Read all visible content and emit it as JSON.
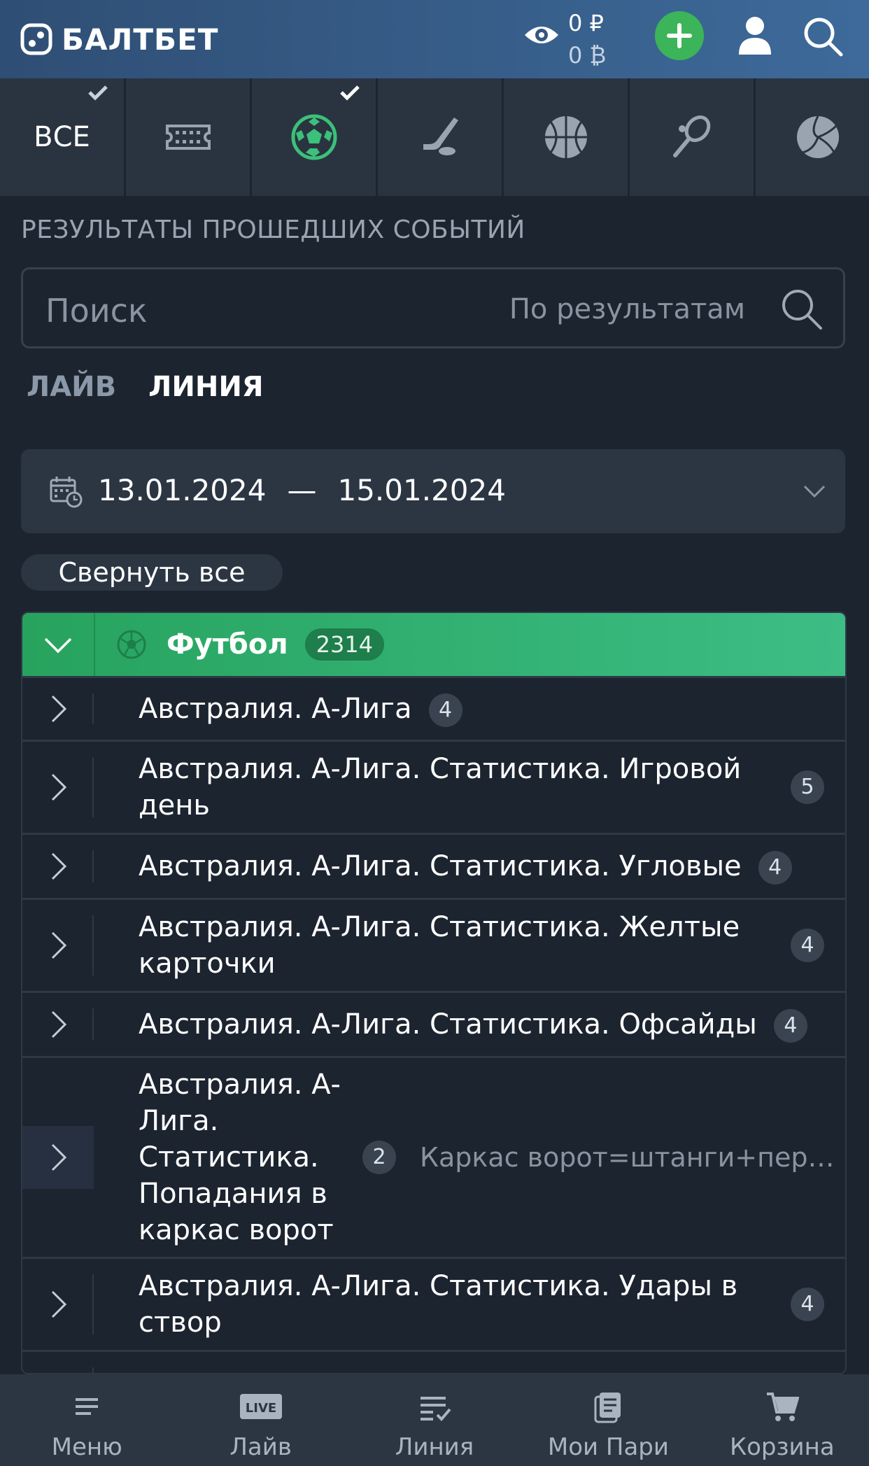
{
  "header": {
    "brand": "БАЛТБЕТ",
    "balance_main": "0 ₽",
    "balance_bonus": "0 ₿"
  },
  "sports_tabs": [
    {
      "label": "ВСЕ",
      "icon": "all",
      "checked": true
    },
    {
      "icon": "ticket-icon",
      "checked": false
    },
    {
      "icon": "football-icon",
      "checked": true
    },
    {
      "icon": "hockey-icon",
      "checked": false
    },
    {
      "icon": "basketball-icon",
      "checked": false
    },
    {
      "icon": "tennis-icon",
      "checked": false
    },
    {
      "icon": "volleyball-icon",
      "checked": false
    }
  ],
  "page": {
    "title": "РЕЗУЛЬТАТЫ ПРОШЕДШИХ СОБЫТИЙ",
    "search_placeholder": "Поиск",
    "search_scope": "По результатам",
    "modes": [
      "ЛАЙВ",
      "ЛИНИЯ"
    ],
    "active_mode": "ЛИНИЯ",
    "date_from": "13.01.2024",
    "date_sep": "—",
    "date_to": "15.01.2024",
    "collapse_all": "Свернуть все"
  },
  "tree": {
    "sport_name": "Футбол",
    "sport_count": "2314",
    "leagues": [
      {
        "label": "Австралия. А-Лига",
        "count": "4"
      },
      {
        "label": "Австралия. А-Лига. Статистика. Игровой день",
        "count": "5"
      },
      {
        "label": "Австралия. А-Лига. Статистика. Угловые",
        "count": "4"
      },
      {
        "label": "Австралия. А-Лига. Статистика. Желтые карточки",
        "count": "4"
      },
      {
        "label": "Австралия. А-Лига. Статистика. Офсайды",
        "count": "4"
      },
      {
        "label": "Австралия. А-Лига. Статистика. Попадания в каркас ворот",
        "count": "2",
        "note": "Каркас ворот=штанги+перекладина"
      },
      {
        "label": "Австралия. А-Лига. Статистика. Удары в створ",
        "count": "4"
      }
    ]
  },
  "bottom_nav": [
    {
      "label": "Меню",
      "icon": "menu-icon"
    },
    {
      "label": "Лайв",
      "icon": "live-icon"
    },
    {
      "label": "Линия",
      "icon": "line-icon"
    },
    {
      "label": "Мои Пари",
      "icon": "my-bets-icon"
    },
    {
      "label": "Корзина",
      "icon": "cart-icon"
    }
  ],
  "colors": {
    "accent_green": "#3cb45a",
    "header_blue": "#3d6a9a",
    "background": "#1c2430"
  }
}
